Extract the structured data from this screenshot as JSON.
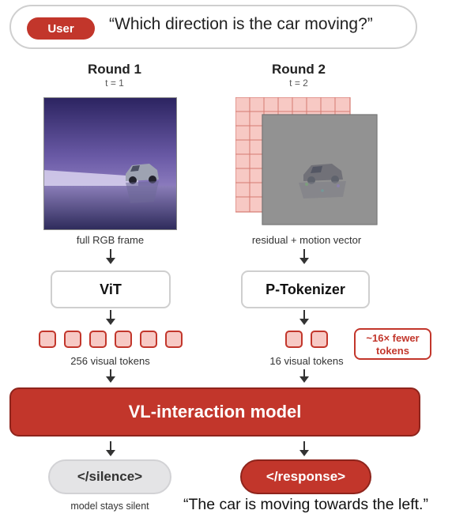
{
  "prompt": {
    "user_label": "User",
    "question": "“Which direction is the car moving?”"
  },
  "round1": {
    "title": "Round 1",
    "subtitle": "t = 1",
    "image_caption": "full RGB frame",
    "encoder": "ViT",
    "token_caption": "256 visual tokens"
  },
  "round2": {
    "title": "Round 2",
    "subtitle": "t = 2",
    "image_caption": "residual + motion vector",
    "encoder": "P-Tokenizer",
    "token_caption": "16 visual tokens",
    "fewer_badge_line1": "~16× fewer",
    "fewer_badge_line2": "tokens"
  },
  "model": {
    "label": "VL-interaction model"
  },
  "outputs": {
    "silence_label": "</silence>",
    "silence_caption": "model stays silent",
    "response_label": "</response>",
    "response_text": "“The car is moving towards the left.”"
  },
  "colors": {
    "accent_red": "#c2362b",
    "token_fill": "#f7c9c4",
    "grid_fill": "#f7c9c4",
    "silence_pill": "#e4e4e6"
  },
  "icons": {
    "arrow": "down-arrow-icon"
  }
}
